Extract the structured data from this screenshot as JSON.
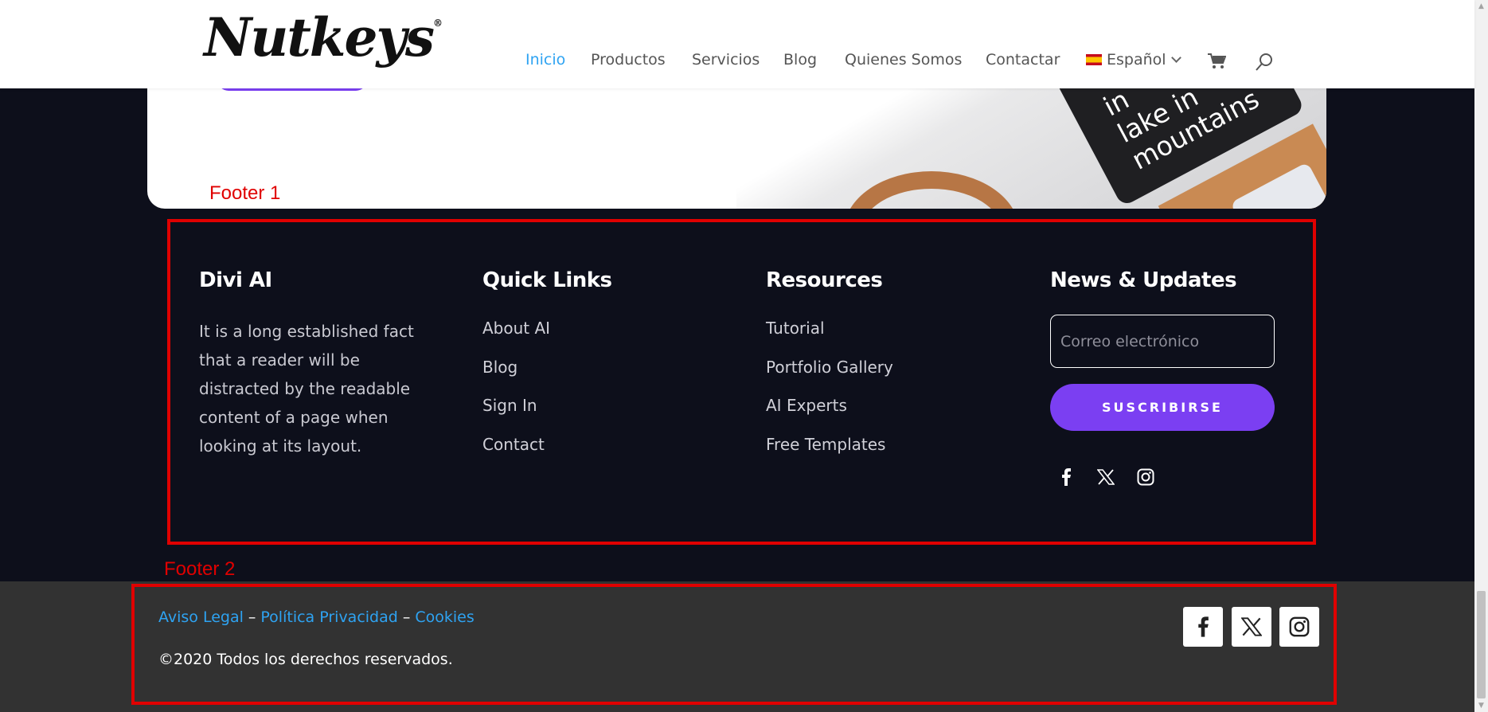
{
  "header": {
    "logo": "Nutkeys",
    "logo_mark": "®",
    "nav": [
      {
        "label": "Inicio",
        "active": true
      },
      {
        "label": "Productos"
      },
      {
        "label": "Servicios"
      },
      {
        "label": "Blog"
      },
      {
        "label": "Quienes Somos"
      },
      {
        "label": "Contactar"
      },
      {
        "label": "Español"
      }
    ],
    "icons": [
      "cart-icon",
      "search-icon"
    ]
  },
  "hero": {
    "tablet_text": "in\nlake in\nmountains"
  },
  "annotations": {
    "footer1": "Footer 1",
    "footer2": "Footer 2",
    "color": "#e00000"
  },
  "footer1": {
    "col1": {
      "title": "Divi AI",
      "text": "It is a long established fact that a reader will be distracted by the readable content of a page when looking at its layout."
    },
    "col2": {
      "title": "Quick Links",
      "links": [
        "About AI",
        "Blog",
        "Sign In",
        "Contact"
      ]
    },
    "col3": {
      "title": "Resources",
      "links": [
        "Tutorial",
        "Portfolio Gallery",
        "AI Experts",
        "Free Templates"
      ]
    },
    "col4": {
      "title": "News & Updates",
      "email_placeholder": "Correo electrónico",
      "subscribe_label": "SUSCRIBIRSE",
      "social": [
        "facebook-icon",
        "x-icon",
        "instagram-icon"
      ]
    }
  },
  "footer2": {
    "links": [
      "Aviso Legal",
      "Política Privacidad",
      "Cookies"
    ],
    "separator": "–",
    "copyright": "©2020 Todos los derechos reservados.",
    "social": [
      "facebook-icon",
      "x-icon",
      "instagram-icon"
    ]
  },
  "colors": {
    "accent": "#7b3ff2",
    "link_blue": "#2ea3f2",
    "dark_bg": "#0d0f1b",
    "bottom_bar": "#323232"
  }
}
